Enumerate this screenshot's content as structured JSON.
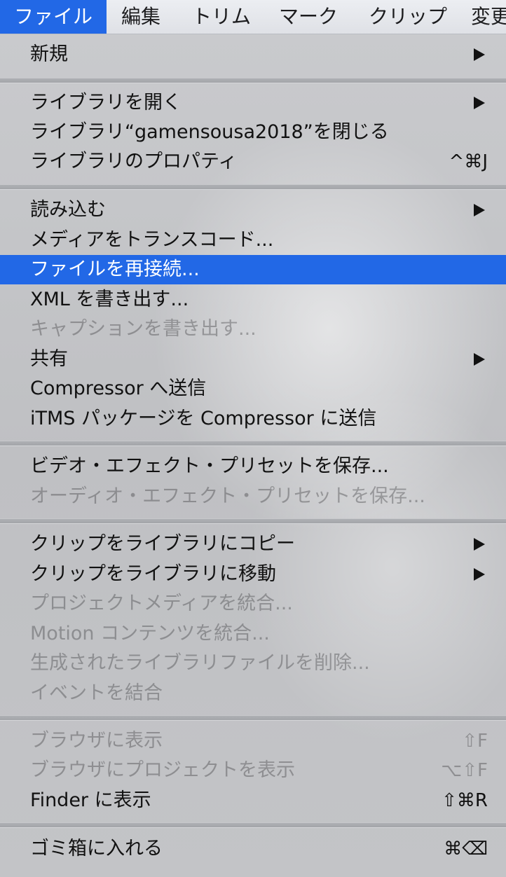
{
  "menubar": {
    "items": [
      {
        "label": "ファイル",
        "active": true
      },
      {
        "label": "編集"
      },
      {
        "label": "トリム"
      },
      {
        "label": "マーク"
      },
      {
        "label": "クリップ"
      },
      {
        "label": "変更"
      }
    ]
  },
  "menu": {
    "groups": [
      {
        "items": [
          {
            "label": "新規",
            "submenu": true,
            "enabled": true
          }
        ]
      },
      {
        "items": [
          {
            "label": "ライブラリを開く",
            "submenu": true,
            "enabled": true
          },
          {
            "label": "ライブラリ“gamensousa2018”を閉じる",
            "enabled": true
          },
          {
            "label": "ライブラリのプロパティ",
            "shortcut": "^⌘J",
            "enabled": true
          }
        ]
      },
      {
        "items": [
          {
            "label": "読み込む",
            "submenu": true,
            "enabled": true
          },
          {
            "label": "メディアをトランスコード...",
            "enabled": true
          },
          {
            "label": "ファイルを再接続...",
            "enabled": true,
            "highlighted": true
          },
          {
            "label": "XML を書き出す...",
            "enabled": true
          },
          {
            "label": "キャプションを書き出す...",
            "enabled": false
          },
          {
            "label": "共有",
            "submenu": true,
            "enabled": true
          },
          {
            "label": "Compressor へ送信",
            "enabled": true
          },
          {
            "label": "iTMS パッケージを Compressor に送信",
            "enabled": true
          }
        ]
      },
      {
        "items": [
          {
            "label": "ビデオ・エフェクト・プリセットを保存...",
            "enabled": true
          },
          {
            "label": "オーディオ・エフェクト・プリセットを保存...",
            "enabled": false
          }
        ]
      },
      {
        "items": [
          {
            "label": "クリップをライブラリにコピー",
            "submenu": true,
            "enabled": true
          },
          {
            "label": "クリップをライブラリに移動",
            "submenu": true,
            "enabled": true
          },
          {
            "label": "プロジェクトメディアを統合...",
            "enabled": false
          },
          {
            "label": "Motion コンテンツを統合...",
            "enabled": false
          },
          {
            "label": "生成されたライブラリファイルを削除...",
            "enabled": false
          },
          {
            "label": "イベントを結合",
            "enabled": false
          }
        ]
      },
      {
        "items": [
          {
            "label": "ブラウザに表示",
            "shortcut": "⇧F",
            "enabled": false
          },
          {
            "label": "ブラウザにプロジェクトを表示",
            "shortcut": "⌥⇧F",
            "enabled": false
          },
          {
            "label": "Finder に表示",
            "shortcut": "⇧⌘R",
            "enabled": true
          }
        ]
      },
      {
        "items": [
          {
            "label": "ゴミ箱に入れる",
            "shortcut": "⌘⌫",
            "enabled": true
          }
        ]
      }
    ]
  },
  "colors": {
    "highlight": "#2268e6",
    "menu_background": "#c5c6c9",
    "text": "#111111",
    "disabled_text": "#9c9da1"
  }
}
